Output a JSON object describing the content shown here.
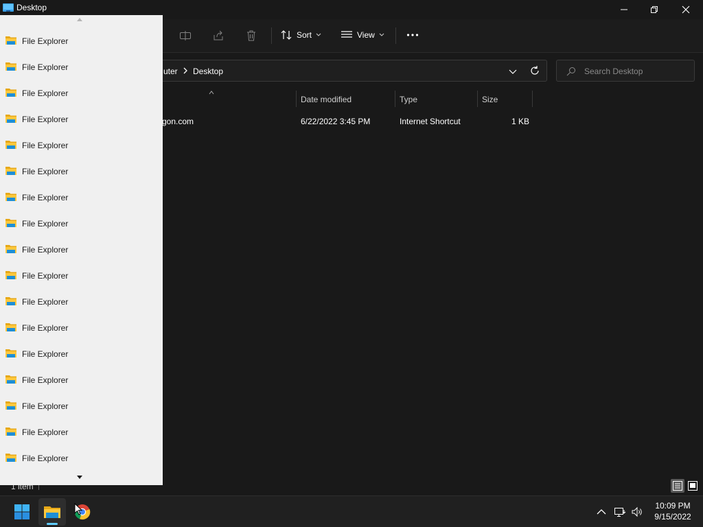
{
  "window": {
    "title": "Desktop",
    "minimize_icon": "minimize-icon",
    "maximize_icon": "restore-icon",
    "close_icon": "close-icon"
  },
  "toolbar": {
    "sort_label": "Sort",
    "view_label": "View",
    "disabled_icons": [
      "rename-icon",
      "share-icon",
      "delete-icon"
    ],
    "more_icon": "more-icon"
  },
  "address": {
    "crumbs": [
      "uter",
      "Desktop"
    ]
  },
  "search": {
    "placeholder": "Search Desktop"
  },
  "columns": [
    "Date modified",
    "Type",
    "Size"
  ],
  "files": [
    {
      "name": "gon.com",
      "date_modified": "6/22/2022 3:45 PM",
      "type": "Internet Shortcut",
      "size": "1 KB"
    }
  ],
  "status": {
    "item_count": "1 item"
  },
  "jumplist": {
    "items": [
      "File Explorer",
      "File Explorer",
      "File Explorer",
      "File Explorer",
      "File Explorer",
      "File Explorer",
      "File Explorer",
      "File Explorer",
      "File Explorer",
      "File Explorer",
      "File Explorer",
      "File Explorer",
      "File Explorer",
      "File Explorer",
      "File Explorer",
      "File Explorer",
      "File Explorer"
    ]
  },
  "taskbar": {
    "apps": [
      "start-icon",
      "file-explorer-icon",
      "chrome-icon"
    ],
    "tray_icons": [
      "chevron-up-icon",
      "network-icon",
      "volume-icon"
    ],
    "time": "10:09 PM",
    "date": "9/15/2022"
  },
  "colors": {
    "background": "#191919",
    "jumplist_bg": "#f0f0f0",
    "accent": "#60cdff",
    "folder_yellow": "#ffc83d"
  }
}
